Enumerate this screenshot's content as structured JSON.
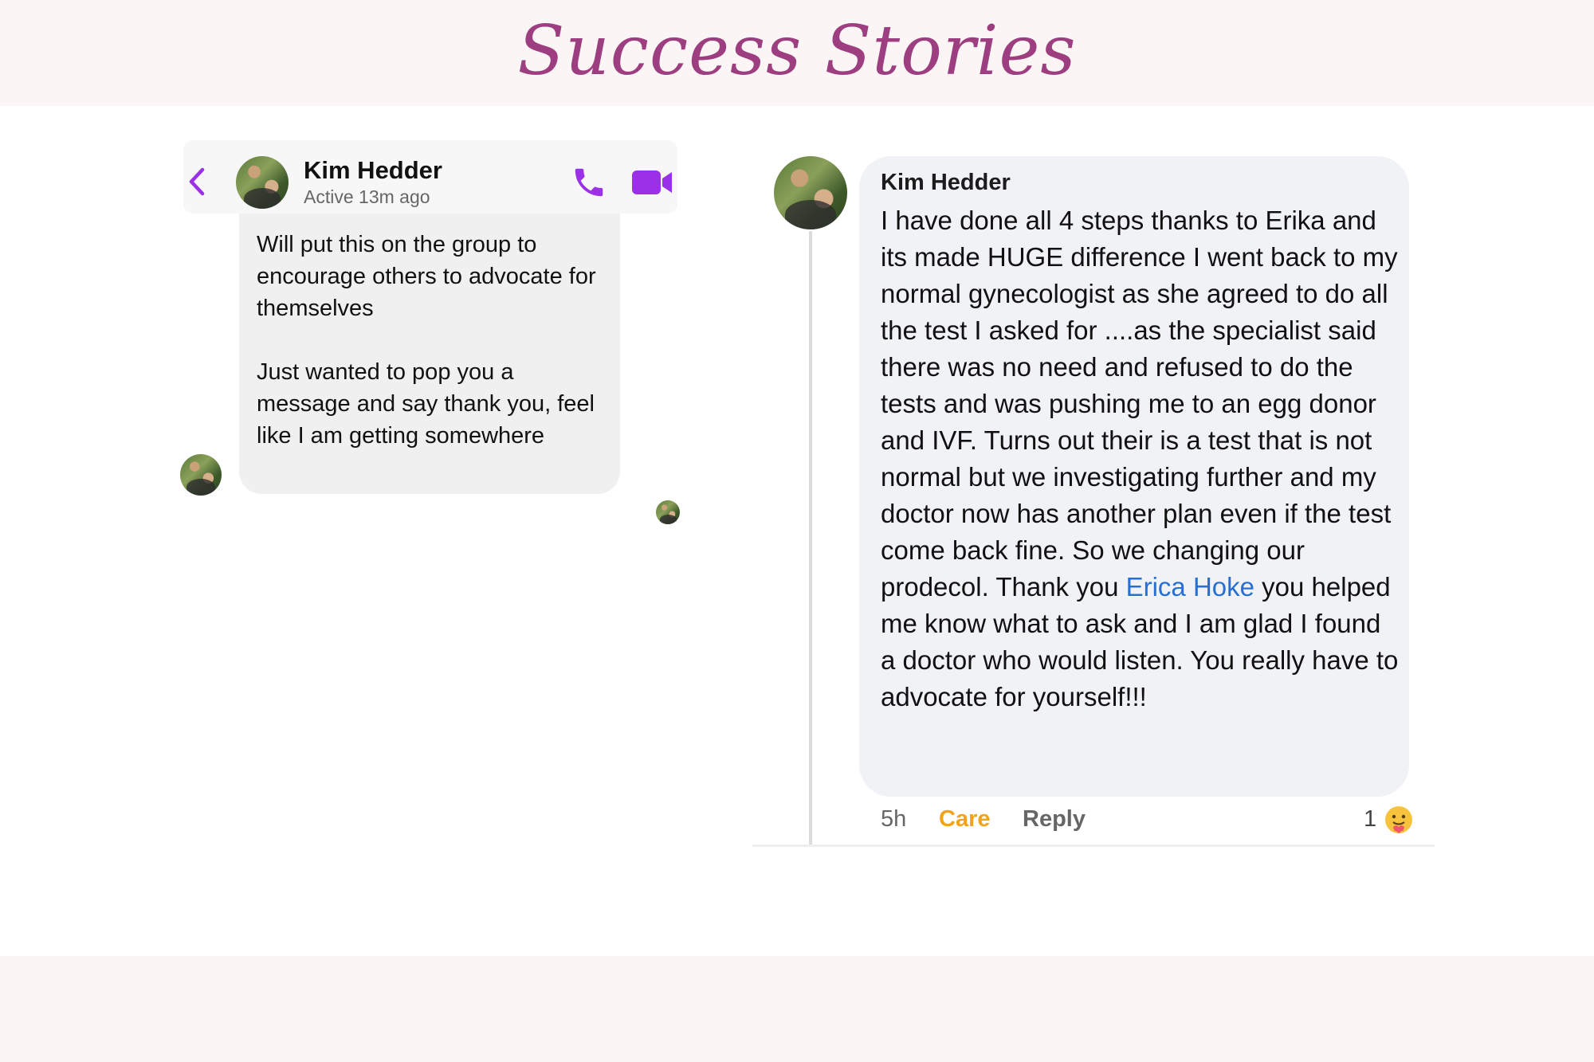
{
  "page": {
    "title": "Success Stories"
  },
  "messenger": {
    "contact_name": "Kim Hedder",
    "status": "Active 13m ago",
    "icons": [
      "back-icon",
      "phone-icon",
      "video-icon"
    ],
    "accent_color": "#9b30e6",
    "message_paragraphs": [
      "Will put this on the group to encourage others to advocate for themselves",
      "Just wanted to pop you a message and say thank you, feel like I am getting somewhere"
    ]
  },
  "comment": {
    "author": "Kim Hedder",
    "text_before_mention": "I have done all 4 steps thanks to Erika and its made HUGE difference I went back to my normal gynecologist as she agreed to do all the test I asked for ....as the specialist said there was no need and refused to do the tests and was pushing me to an egg donor and IVF. Turns out their is a test that is not normal but we investigating further and my doctor now has another plan even if the test come back fine. So we changing our prodecol. Thank you ",
    "mention": "Erica Hoke",
    "text_after_mention": " you helped me know what to ask and I am glad I found a doctor who would listen. You really have to advocate for yourself!!!",
    "time": "5h",
    "reaction_label": "Care",
    "reply_label": "Reply",
    "reaction_count": "1",
    "reaction_icon": "care-emoji",
    "mention_color": "#2670d1",
    "care_color": "#f2a31c"
  }
}
